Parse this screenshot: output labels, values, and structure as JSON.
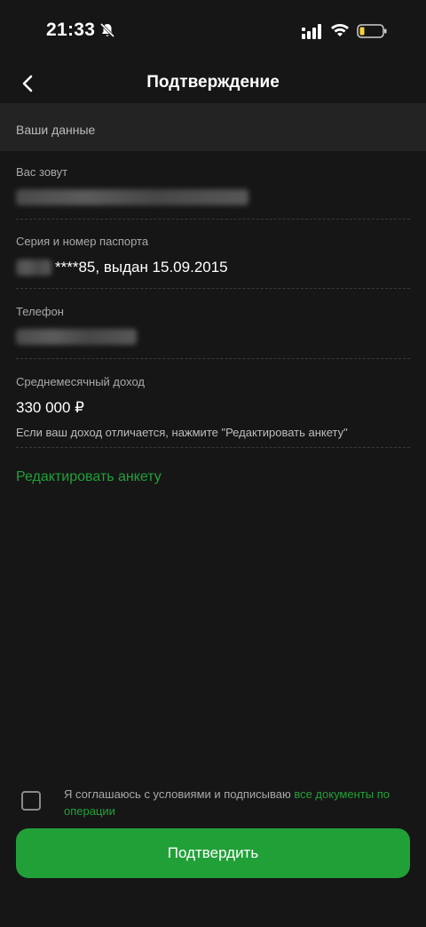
{
  "status_bar": {
    "time": "21:33"
  },
  "header": {
    "title": "Подтверждение"
  },
  "section": {
    "title": "Ваши данные"
  },
  "fields": {
    "name": {
      "label": "Вас зовут"
    },
    "passport": {
      "label": "Серия и номер паспорта",
      "value": "****85, выдан 15.09.2015"
    },
    "phone": {
      "label": "Телефон"
    },
    "income": {
      "label": "Среднемесячный доход",
      "value": "330 000 ₽",
      "hint": "Если ваш доход отличается, нажмите \"Редактировать анкету\""
    }
  },
  "edit_link": "Редактировать анкету",
  "agreement": {
    "text": "Я соглашаюсь с условиями и подписываю ",
    "link": "все документы по операции"
  },
  "confirm_button": "Подтвердить",
  "colors": {
    "accent": "#21a038",
    "background": "#161616",
    "section": "#232323"
  }
}
